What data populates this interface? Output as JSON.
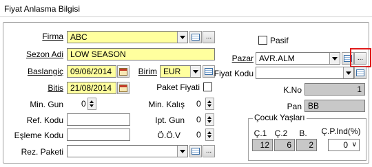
{
  "window": {
    "title": "Fiyat Anlasma Bilgisi"
  },
  "fields": {
    "firma": {
      "label": "Firma",
      "value": "ABC"
    },
    "sezon_adi": {
      "label": "Sezon Adi",
      "value": "LOW SEASON"
    },
    "baslangic": {
      "label": "Baslangiç",
      "value": "09/06/2014"
    },
    "birim": {
      "label": "Birim",
      "value": "EUR"
    },
    "bitis": {
      "label": "Bitis",
      "value": "21/08/2014"
    },
    "paket_fiyati": {
      "label": "Paket Fiyati",
      "checked": false
    },
    "min_gun": {
      "label": "Min. Gun",
      "value": "0"
    },
    "min_kalis": {
      "label": "Min. Kalış",
      "value": "0"
    },
    "ref_kodu": {
      "label": "Ref. Kodu",
      "value": ""
    },
    "ipt_gun": {
      "label": "Ipt. Gun",
      "value": "0"
    },
    "esleme_kodu": {
      "label": "Eşleme Kodu",
      "value": ""
    },
    "oov": {
      "label": "Ö.Ö.V",
      "value": "0"
    },
    "rez_paketi": {
      "label": "Rez. Paketi",
      "value": ""
    },
    "pasif": {
      "label": "Pasif",
      "checked": false
    },
    "pazar": {
      "label": "Pazar",
      "value": "AVR.ALM"
    },
    "fiyat_kodu": {
      "label": "Fiyat Kodu",
      "value": ""
    },
    "kno": {
      "label": "K.No",
      "value": "1"
    },
    "pan": {
      "label": "Pan",
      "value": "BB"
    }
  },
  "cocuk": {
    "title": "Çocuk Yaşları",
    "c1": {
      "label": "Ç.1",
      "value": "12"
    },
    "c2": {
      "label": "Ç.2",
      "value": "6"
    },
    "b": {
      "label": "B.",
      "value": "2"
    },
    "cpind": {
      "label": "Ç.P.Ind(%)",
      "value": "0"
    }
  },
  "buttons": {
    "ellipsis": "..."
  },
  "colors": {
    "highlight": "#e01a1a",
    "required_field": "#ffff9e",
    "readonly_field": "#c8c8c8"
  },
  "icons": [
    "table-lookup-icon",
    "calendar-icon",
    "dropdown-arrow-icon",
    "ellipsis-icon"
  ]
}
